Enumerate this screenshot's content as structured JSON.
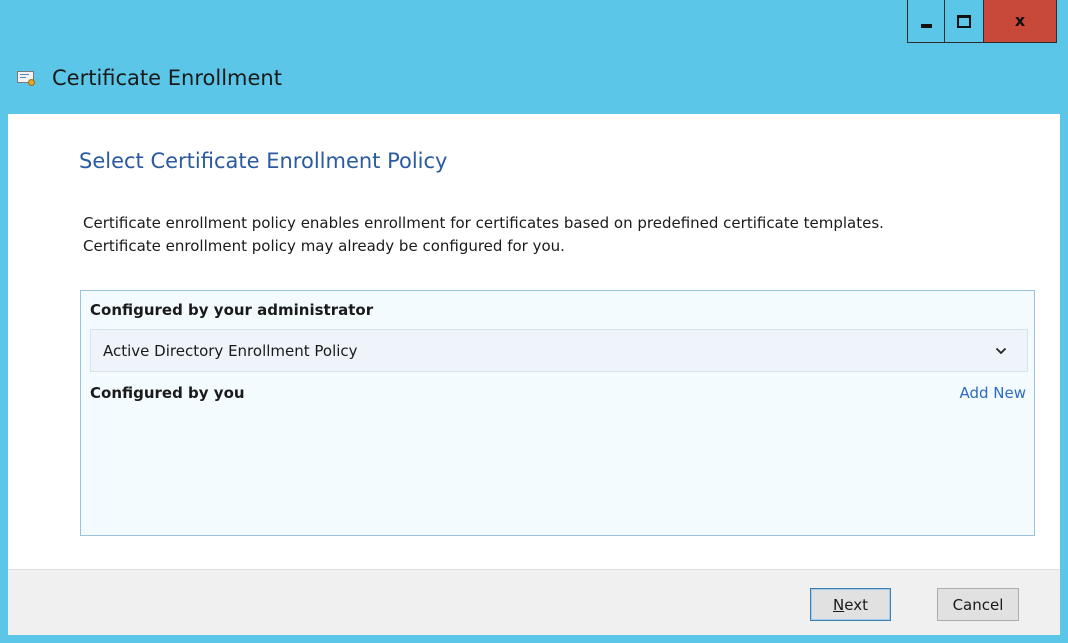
{
  "window": {
    "title": "Certificate Enrollment",
    "controls": {
      "minimize_icon": "minimize-icon",
      "maximize_icon": "maximize-icon",
      "close_glyph": "x"
    },
    "accent_color": "#5bc6e8",
    "close_color": "#c8493a"
  },
  "page": {
    "heading": "Select Certificate Enrollment Policy",
    "description_line1": "Certificate enrollment policy enables enrollment for certificates based on predefined certificate templates.",
    "description_line2": "Certificate enrollment policy may already be configured for you."
  },
  "policies": {
    "admin_label": "Configured by your administrator",
    "admin_items": [
      {
        "name": "Active Directory Enrollment Policy"
      }
    ],
    "user_label": "Configured by you",
    "add_new_label": "Add New"
  },
  "footer": {
    "next_mnemonic": "N",
    "next_rest": "ext",
    "cancel_label": "Cancel"
  }
}
